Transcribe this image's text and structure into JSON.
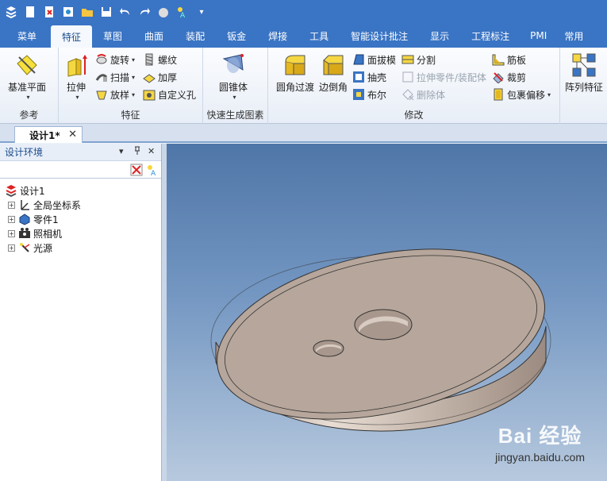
{
  "qat": {
    "icons": [
      "app-menu-icon",
      "new-icon",
      "open-icon",
      "save-as-icon",
      "folder-icon",
      "save-icon",
      "undo-icon",
      "redo-icon",
      "render-icon",
      "smart-icon",
      "dropdown-icon"
    ]
  },
  "tabs": [
    "菜单",
    "特征",
    "草图",
    "曲面",
    "装配",
    "钣金",
    "焊接",
    "工具",
    "智能设计批注",
    "显示",
    "工程标注",
    "PMI",
    "常用"
  ],
  "active_tab": "特征",
  "ribbon": {
    "reference": {
      "label": "参考",
      "plane": "基准平面"
    },
    "feature": {
      "label": "特征",
      "extrude": "拉伸",
      "revolve": "旋转",
      "sweep": "扫描",
      "loft": "放样",
      "thread": "螺纹",
      "thicken": "加厚",
      "custom_hole": "自定义孔"
    },
    "quick": {
      "label": "快速生成图素",
      "cone": "圆锥体"
    },
    "modify": {
      "label": "修改",
      "fillet": "圆角过渡",
      "chamfer": "边倒角",
      "draft": "面拔模",
      "shell": "抽壳",
      "boolean": "布尔",
      "split": "分割",
      "extend_part": "拉伸零件/装配体",
      "delete_body": "删除体",
      "rib": "筋板",
      "trim": "裁剪",
      "wrap": "包裹偏移"
    },
    "array": {
      "label": "阵列特征"
    }
  },
  "doc_tab": {
    "title": "设计1*",
    "close": "✕"
  },
  "panel": {
    "title": "设计环境",
    "pin": "ᆞ",
    "close": "✕",
    "dropdown": "▾",
    "tree": {
      "root": "设计1",
      "items": [
        "全局坐标系",
        "零件1",
        "照相机",
        "光源"
      ]
    }
  },
  "watermark": {
    "brand": "Bai 经验",
    "url": "jingyan.baidu.com"
  },
  "colors": {
    "titlebar": "#3a74c4",
    "viewport_top": "#4f76a8",
    "viewport_bottom": "#b7c9de",
    "part": "#b5a59a"
  }
}
